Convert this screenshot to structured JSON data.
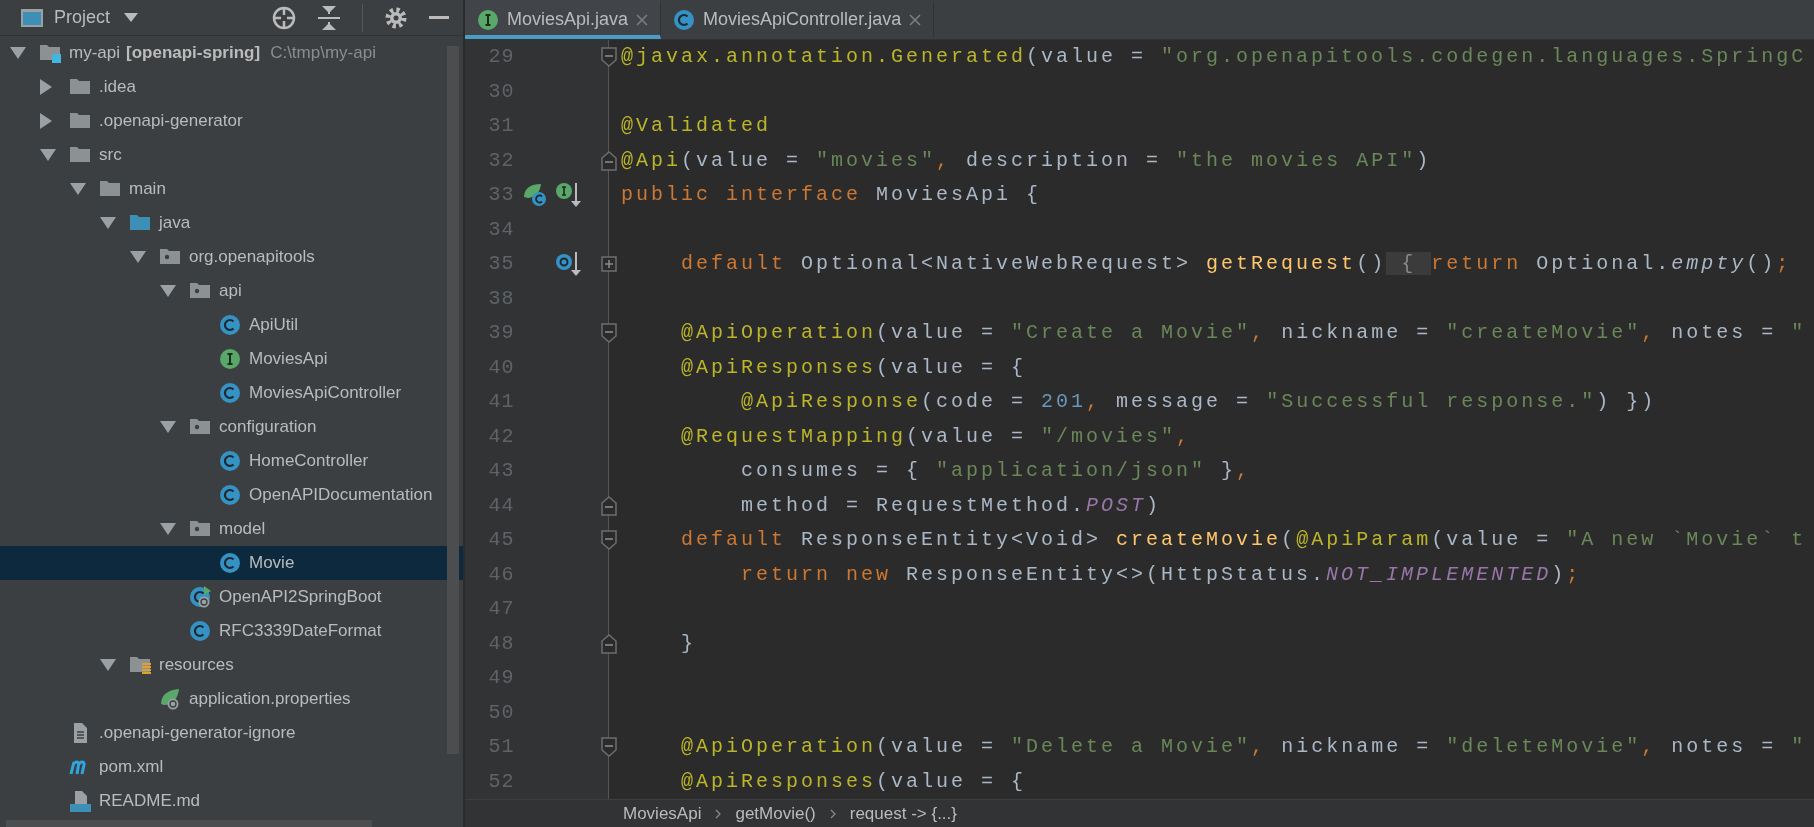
{
  "project_panel": {
    "title": "Project"
  },
  "tree": [
    {
      "label": "my-api",
      "tag": "[openapi-spring]",
      "path": "C:\\tmp\\my-api",
      "kind": "module",
      "expanded": true,
      "selected": false,
      "children": [
        {
          "label": ".idea",
          "kind": "folder",
          "expanded": false,
          "selected": false
        },
        {
          "label": ".openapi-generator",
          "kind": "folder",
          "expanded": false,
          "selected": false
        },
        {
          "label": "src",
          "kind": "folder",
          "expanded": true,
          "selected": false,
          "children": [
            {
              "label": "main",
              "kind": "folder",
              "expanded": true,
              "selected": false,
              "children": [
                {
                  "label": "java",
                  "kind": "source",
                  "expanded": true,
                  "selected": false,
                  "children": [
                    {
                      "label": "org.openapitools",
                      "kind": "package",
                      "expanded": true,
                      "selected": false,
                      "children": [
                        {
                          "label": "api",
                          "kind": "package",
                          "expanded": true,
                          "selected": false,
                          "children": [
                            {
                              "label": "ApiUtil",
                              "kind": "class",
                              "selected": false
                            },
                            {
                              "label": "MoviesApi",
                              "kind": "interface",
                              "selected": false
                            },
                            {
                              "label": "MoviesApiController",
                              "kind": "class",
                              "selected": false
                            }
                          ]
                        },
                        {
                          "label": "configuration",
                          "kind": "package",
                          "expanded": true,
                          "selected": false,
                          "children": [
                            {
                              "label": "HomeController",
                              "kind": "class",
                              "selected": false
                            },
                            {
                              "label": "OpenAPIDocumentation",
                              "kind": "class",
                              "selected": false
                            }
                          ]
                        },
                        {
                          "label": "model",
                          "kind": "package",
                          "expanded": true,
                          "selected": false,
                          "children": [
                            {
                              "label": "Movie",
                              "kind": "class",
                              "selected": true
                            }
                          ]
                        },
                        {
                          "label": "OpenAPI2SpringBoot",
                          "kind": "boot",
                          "selected": false
                        },
                        {
                          "label": "RFC3339DateFormat",
                          "kind": "class",
                          "selected": false
                        }
                      ]
                    }
                  ]
                },
                {
                  "label": "resources",
                  "kind": "resources",
                  "expanded": true,
                  "selected": false,
                  "children": [
                    {
                      "label": "application.properties",
                      "kind": "props",
                      "selected": false
                    }
                  ]
                }
              ]
            }
          ]
        },
        {
          "label": ".openapi-generator-ignore",
          "kind": "text",
          "selected": false
        },
        {
          "label": "pom.xml",
          "kind": "maven",
          "selected": false
        },
        {
          "label": "README.md",
          "kind": "markdown",
          "selected": false
        }
      ]
    }
  ],
  "editor": {
    "tabs": [
      {
        "label": "MoviesApi.java",
        "kind": "interface",
        "selected": true
      },
      {
        "label": "MoviesApiController.java",
        "kind": "class",
        "selected": false
      }
    ],
    "lines": [
      {
        "number": "29",
        "fold_marker": {
          "kind": "start"
        },
        "tokens": [
          {
            "kind": "annotation",
            "text": "@javax.annotation.Generated"
          },
          {
            "kind": "plain",
            "text": "(value = "
          },
          {
            "kind": "string",
            "text": "\"org.openapitools.codegen.languages.SpringC"
          }
        ]
      },
      {
        "number": "30"
      },
      {
        "number": "31",
        "tokens": [
          {
            "kind": "annotation",
            "text": "@Validated"
          }
        ]
      },
      {
        "number": "32",
        "fold_marker": {
          "kind": "end"
        },
        "tokens": [
          {
            "kind": "annotation",
            "text": "@Api"
          },
          {
            "kind": "plain",
            "text": "(value = "
          },
          {
            "kind": "string",
            "text": "\"movies\""
          },
          {
            "kind": "keyword",
            "text": ", "
          },
          {
            "kind": "plain",
            "text": "description = "
          },
          {
            "kind": "string",
            "text": "\"the movies API\""
          },
          {
            "kind": "plain",
            "text": ")"
          }
        ]
      },
      {
        "number": "33",
        "gutter_icons": [
          {
            "kind": "bean"
          },
          {
            "kind": "implemented"
          }
        ],
        "tokens": [
          {
            "kind": "keyword",
            "text": "public interface "
          },
          {
            "kind": "plain",
            "text": "MoviesApi {"
          }
        ]
      },
      {
        "number": "34"
      },
      {
        "number": "35",
        "fold_marker": {
          "kind": "collapsed"
        },
        "gutter_icons": [
          {
            "kind": "overridden"
          }
        ],
        "tokens": [
          {
            "kind": "keyword",
            "text": "    default "
          },
          {
            "kind": "plain",
            "text": "Optional<NativeWebRequest> "
          },
          {
            "kind": "method",
            "text": "getRequest"
          },
          {
            "kind": "plain",
            "text": "()"
          },
          {
            "kind": "folded",
            "text": " { "
          },
          {
            "kind": "keyword",
            "text": "return "
          },
          {
            "kind": "plain",
            "text": "Optional."
          },
          {
            "kind": "italic",
            "text": "empty"
          },
          {
            "kind": "plain",
            "text": "()"
          },
          {
            "kind": "keyword",
            "text": ";"
          }
        ]
      },
      {
        "number": "38"
      },
      {
        "number": "39",
        "fold_marker": {
          "kind": "start"
        },
        "tokens": [
          {
            "kind": "annotation",
            "text": "    @ApiOperation"
          },
          {
            "kind": "plain",
            "text": "(value = "
          },
          {
            "kind": "string",
            "text": "\"Create a Movie\""
          },
          {
            "kind": "keyword",
            "text": ", "
          },
          {
            "kind": "plain",
            "text": "nickname = "
          },
          {
            "kind": "string",
            "text": "\"createMovie\""
          },
          {
            "kind": "keyword",
            "text": ", "
          },
          {
            "kind": "plain",
            "text": "notes = "
          },
          {
            "kind": "string",
            "text": "\""
          }
        ]
      },
      {
        "number": "40",
        "tokens": [
          {
            "kind": "annotation",
            "text": "    @ApiResponses"
          },
          {
            "kind": "plain",
            "text": "(value = {"
          }
        ]
      },
      {
        "number": "41",
        "tokens": [
          {
            "kind": "annotation",
            "text": "        @ApiResponse"
          },
          {
            "kind": "plain",
            "text": "(code = "
          },
          {
            "kind": "number",
            "text": "201"
          },
          {
            "kind": "keyword",
            "text": ", "
          },
          {
            "kind": "plain",
            "text": "message = "
          },
          {
            "kind": "string",
            "text": "\"Successful response.\""
          },
          {
            "kind": "plain",
            "text": ") })"
          }
        ]
      },
      {
        "number": "42",
        "tokens": [
          {
            "kind": "annotation",
            "text": "    @RequestMapping"
          },
          {
            "kind": "plain",
            "text": "(value = "
          },
          {
            "kind": "string",
            "text": "\"/movies\""
          },
          {
            "kind": "keyword",
            "text": ","
          }
        ]
      },
      {
        "number": "43",
        "tokens": [
          {
            "kind": "plain",
            "text": "        consumes = { "
          },
          {
            "kind": "string",
            "text": "\"application/json\""
          },
          {
            "kind": "plain",
            "text": " }"
          },
          {
            "kind": "keyword",
            "text": ","
          }
        ]
      },
      {
        "number": "44",
        "fold_marker": {
          "kind": "end"
        },
        "tokens": [
          {
            "kind": "plain",
            "text": "        method = RequestMethod."
          },
          {
            "kind": "constant",
            "text": "POST"
          },
          {
            "kind": "plain",
            "text": ")"
          }
        ]
      },
      {
        "number": "45",
        "fold_marker": {
          "kind": "start"
        },
        "tokens": [
          {
            "kind": "keyword",
            "text": "    default "
          },
          {
            "kind": "plain",
            "text": "ResponseEntity<Void> "
          },
          {
            "kind": "method",
            "text": "createMovie"
          },
          {
            "kind": "plain",
            "text": "("
          },
          {
            "kind": "annotation",
            "text": "@ApiParam"
          },
          {
            "kind": "plain",
            "text": "(value = "
          },
          {
            "kind": "string",
            "text": "\"A new `Movie` t"
          }
        ]
      },
      {
        "number": "46",
        "tokens": [
          {
            "kind": "keyword",
            "text": "        return new "
          },
          {
            "kind": "plain",
            "text": "ResponseEntity<>(HttpStatus."
          },
          {
            "kind": "constant",
            "text": "NOT_IMPLEMENTED"
          },
          {
            "kind": "plain",
            "text": ")"
          },
          {
            "kind": "keyword",
            "text": ";"
          }
        ]
      },
      {
        "number": "47"
      },
      {
        "number": "48",
        "fold_marker": {
          "kind": "end"
        },
        "tokens": [
          {
            "kind": "plain",
            "text": "    }"
          }
        ]
      },
      {
        "number": "49"
      },
      {
        "number": "50"
      },
      {
        "number": "51",
        "fold_marker": {
          "kind": "start"
        },
        "tokens": [
          {
            "kind": "annotation",
            "text": "    @ApiOperation"
          },
          {
            "kind": "plain",
            "text": "(value = "
          },
          {
            "kind": "string",
            "text": "\"Delete a Movie\""
          },
          {
            "kind": "keyword",
            "text": ", "
          },
          {
            "kind": "plain",
            "text": "nickname = "
          },
          {
            "kind": "string",
            "text": "\"deleteMovie\""
          },
          {
            "kind": "keyword",
            "text": ", "
          },
          {
            "kind": "plain",
            "text": "notes = "
          },
          {
            "kind": "string",
            "text": "\""
          }
        ]
      },
      {
        "number": "52",
        "tokens": [
          {
            "kind": "annotation",
            "text": "    @ApiResponses"
          },
          {
            "kind": "plain",
            "text": "(value = {"
          }
        ]
      }
    ],
    "breadcrumbs": [
      "MoviesApi",
      "getMovie()",
      "request -> {...}"
    ]
  }
}
